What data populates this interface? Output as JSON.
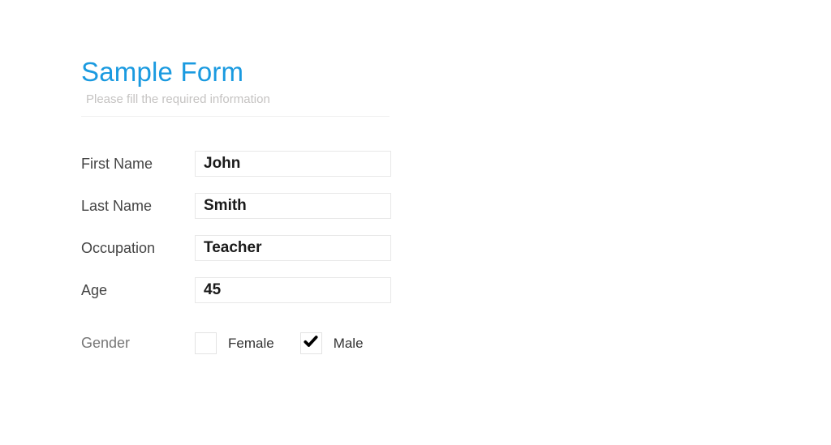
{
  "header": {
    "title": "Sample Form",
    "subtitle": "Please fill the required information"
  },
  "fields": {
    "first_name": {
      "label": "First Name",
      "value": "John"
    },
    "last_name": {
      "label": "Last Name",
      "value": "Smith"
    },
    "occupation": {
      "label": "Occupation",
      "value": "Teacher"
    },
    "age": {
      "label": "Age",
      "value": "45"
    }
  },
  "gender": {
    "label": "Gender",
    "options": {
      "female": {
        "label": "Female",
        "checked": false
      },
      "male": {
        "label": "Male",
        "checked": true
      }
    }
  }
}
